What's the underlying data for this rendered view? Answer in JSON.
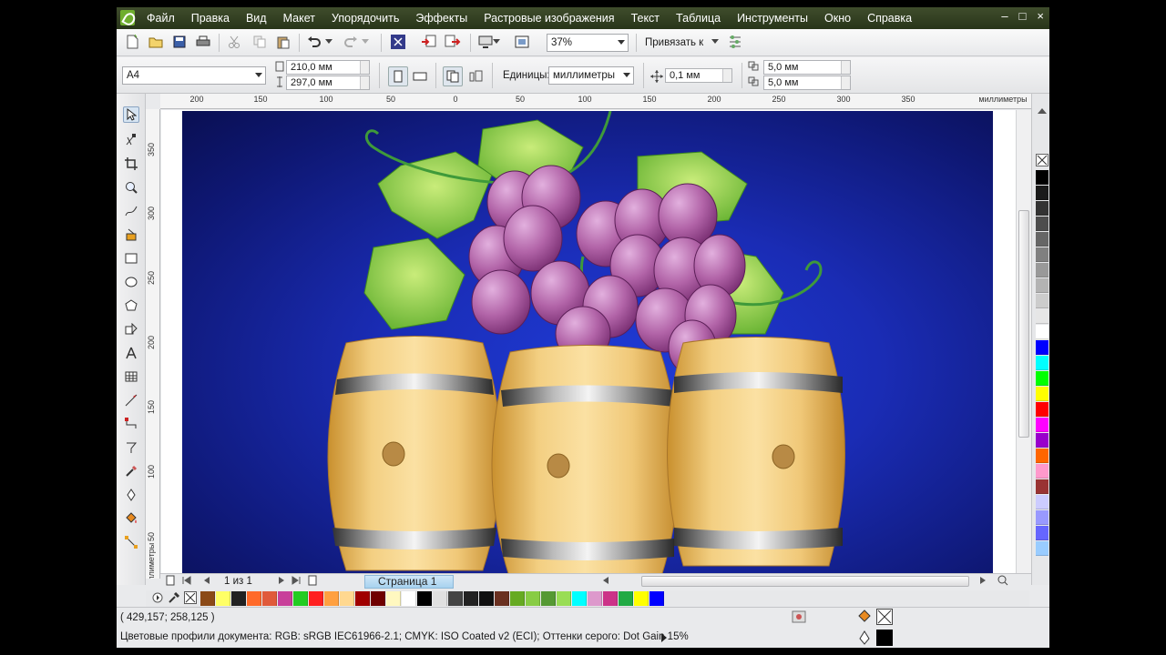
{
  "menu": {
    "items": [
      "Файл",
      "Правка",
      "Вид",
      "Макет",
      "Упорядочить",
      "Эффекты",
      "Растровые изображения",
      "Текст",
      "Таблица",
      "Инструменты",
      "Окно",
      "Справка"
    ],
    "win_minimize": "–",
    "win_restore": "□",
    "win_close": "×"
  },
  "standard_toolbar": {
    "zoom": "37%",
    "snap_label": "Привязать к"
  },
  "property_bar": {
    "page_size": "A4",
    "width": "210,0 мм",
    "height": "297,0 мм",
    "units_label": "Единицы:",
    "units_value": "миллиметры",
    "nudge": "0,1 мм",
    "dup_x": "5,0 мм",
    "dup_y": "5,0 мм"
  },
  "ruler": {
    "h_ticks": [
      "200",
      "150",
      "100",
      "50",
      "0",
      "50",
      "100",
      "150",
      "200",
      "250",
      "300",
      "350"
    ],
    "h_unit": "миллиметры",
    "v_ticks": [
      "350",
      "300",
      "250",
      "200",
      "150",
      "100",
      "50"
    ],
    "v_unit": "миллиметры"
  },
  "page_nav": {
    "counter": "1 из 1",
    "tab": "Страница 1"
  },
  "status": {
    "coords": "( 429,157; 258,125 )",
    "color_profiles": "Цветовые профили документа: RGB: sRGB IEC61966-2.1; CMYK: ISO Coated v2 (ECI); Оттенки серого: Dot Gain 15%"
  },
  "icons": {
    "new": "new-document-icon",
    "open": "open-icon",
    "save": "save-icon",
    "print": "print-icon",
    "cut": "cut-icon",
    "copy": "copy-icon",
    "paste": "paste-icon",
    "undo": "undo-icon",
    "redo": "redo-icon",
    "import": "import-icon",
    "export": "export-icon",
    "pick": "pick-tool-icon",
    "zoom": "zoom-tool-icon",
    "fill": "fill-tool-icon",
    "text": "text-tool-icon"
  },
  "colors": {
    "menubar": "#2f3d20",
    "artwork_bg": "#1a2cb5",
    "page_tab": "#a7d2ef"
  },
  "palette_h": [
    "#8b4a17",
    "#ffff66",
    "#222222",
    "#ff6a2a",
    "#e05a3a",
    "#c8409a",
    "#22cc22",
    "#ff2020",
    "#ffa040",
    "#ffd890",
    "#a00000",
    "#700000",
    "#fff8c0",
    "#ffffff",
    "#000000",
    "#e0e0e0",
    "#444444",
    "#222222",
    "#101010",
    "#6a3020",
    "#66aa22",
    "#88cc44",
    "#559933",
    "#99dd55",
    "#00ffff",
    "#dd99cc",
    "#cc3388",
    "#22aa44",
    "#ffff00",
    "#0000ff"
  ],
  "palette_v": [
    "#000000",
    "#1a1a1a",
    "#333333",
    "#4d4d4d",
    "#666666",
    "#808080",
    "#999999",
    "#b3b3b3",
    "#cccccc",
    "#e6e6e6",
    "#ffffff",
    "#0000ff",
    "#00ffff",
    "#00ff00",
    "#ffff00",
    "#ff0000",
    "#ff00ff",
    "#9900cc",
    "#ff6600",
    "#ff99cc",
    "#993333",
    "#ccccff",
    "#9999ff",
    "#6666ff",
    "#99ccff"
  ]
}
